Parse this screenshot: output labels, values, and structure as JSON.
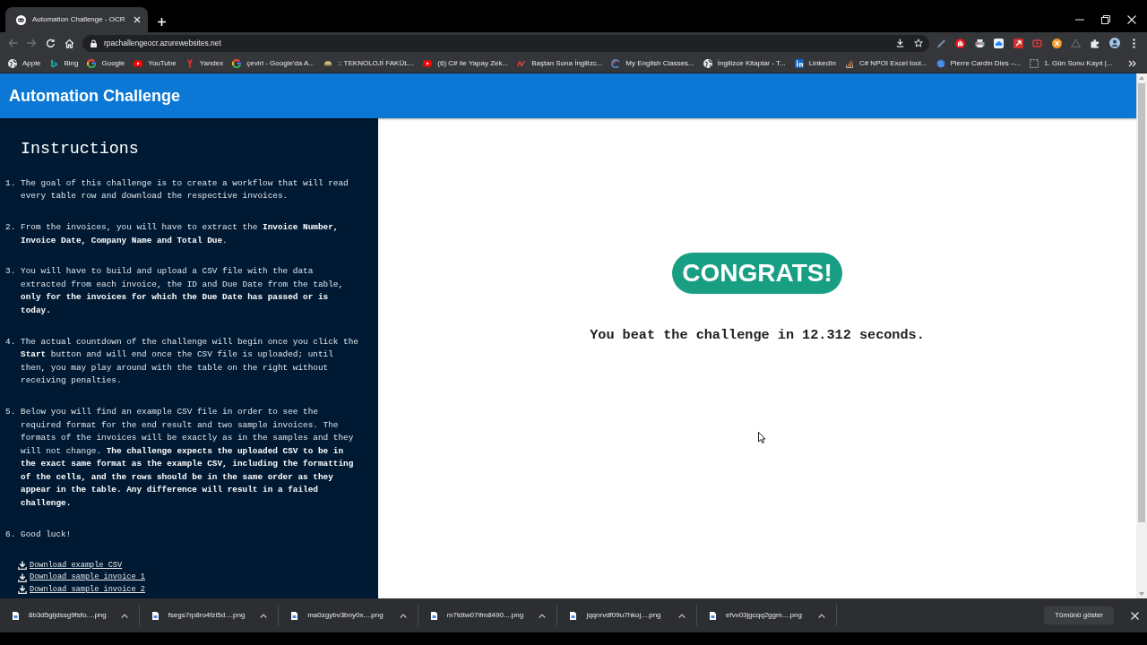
{
  "browser": {
    "tabs": [
      {
        "title": "Automation Challenge - OCR",
        "selected": true
      }
    ],
    "back": {
      "disabled": true
    },
    "forward": {
      "disabled": true
    },
    "address": "rpachallengeocr.azurewebsites.net",
    "bookmarks": [
      {
        "label": "Apple",
        "kind": "globe"
      },
      {
        "label": "Bing",
        "kind": "ribbon"
      },
      {
        "label": "Google",
        "kind": "ring"
      },
      {
        "label": "YouTube",
        "kind": "video"
      },
      {
        "label": "Yandex",
        "kind": "fork"
      },
      {
        "label": "çeviri - Google'da A...",
        "kind": "ring"
      },
      {
        "label": ":: TEKNOLOJİ FAKÜL...",
        "kind": "dome"
      },
      {
        "label": "(6) C# ile Yapay Zek...",
        "kind": "video"
      },
      {
        "label": "Baştan Sona İngilizc...",
        "kind": "curl"
      },
      {
        "label": "My English Classes...",
        "kind": "swirl"
      },
      {
        "label": "İngilizce Kitaplar - T...",
        "kind": "globe"
      },
      {
        "label": "LinkedIn",
        "kind": "tile"
      },
      {
        "label": "C# NPOI Excel tool...",
        "kind": "stack"
      },
      {
        "label": "Pierre Cardin Dies –...",
        "kind": "sphere"
      },
      {
        "label": "1. Gün Sonu Kayıt |...",
        "kind": "square"
      }
    ]
  },
  "page": {
    "title": "Automation Challenge",
    "instructions": {
      "heading": "Instructions",
      "steps": [
        {
          "number": "1.",
          "text": "The goal of this challenge is to create a workflow that will read every table row and download the respective invoices."
        },
        {
          "number": "2.",
          "text": "From the invoices, you will have to extract the **Invoice Number, Invoice Date, Company Name and Total Due**."
        },
        {
          "number": "3.",
          "text": "You will have to build and upload a CSV file with the data extracted from each invoice, the ID and Due Date from the table, **only for the invoices for which the Due Date has passed or is today.**"
        },
        {
          "number": "4.",
          "text": "The actual countdown of the challenge will begin once you click the **Start** button and will end once the CSV file is uploaded; until then, you may play around with the table on the right without receiving penalties."
        },
        {
          "number": "5.",
          "text": "Below you will find an example CSV file in order to see the required format for the end result and two sample invoices. The formats of the invoices will be exactly as in the samples and they will not change. **The challenge expects the uploaded CSV to be in the exact same format as the example CSV, including the formatting of the cells, and the rows should be in the same order as they appear in the table. Any difference will result in a failed challenge.**"
        },
        {
          "number": "6.",
          "text": "Good luck!"
        }
      ],
      "links": [
        "Download example CSV",
        "Download sample invoice 1",
        "Download sample invoice 2"
      ]
    },
    "result": {
      "banner": "CONGRATS!",
      "message": "You beat the challenge in 12.312 seconds."
    }
  },
  "downloads": {
    "files": [
      "8b3d5gljdssg9fsfo....png",
      "fsegs7rp8ro4fzi5d....png",
      "ma0zgybv3bny0x....png",
      "m7tdtw07ifm8490....png",
      "jqqnrvdf09u7hkoj....png",
      "efvv03jgcqq2ggm....png"
    ],
    "show_all": "Tümünü göster"
  }
}
